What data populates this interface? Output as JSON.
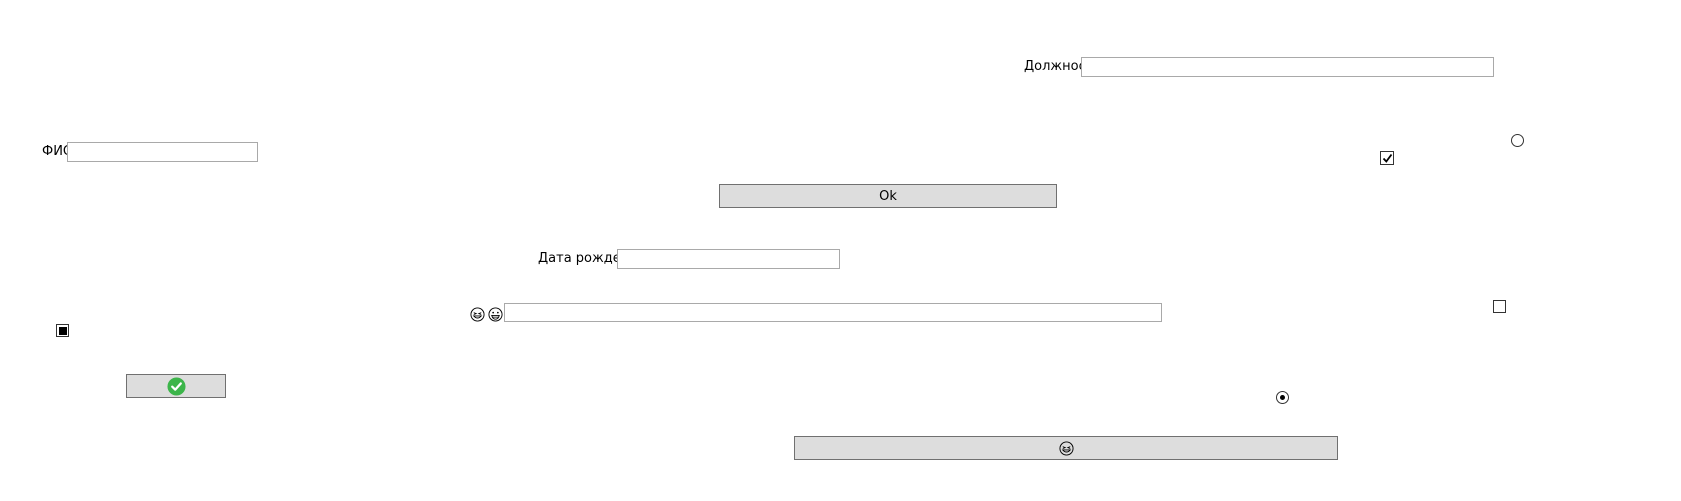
{
  "form": {
    "position_label": "Должность",
    "position_value": "",
    "fio_label": "ФИО",
    "fio_value": "",
    "birthdate_label": "Дата рождения",
    "birthdate_value": "",
    "emoji_field_value": "",
    "ok_button_label": "Ok"
  },
  "controls": {
    "checkbox_checked": true,
    "checkbox_indeterminate": true,
    "checkbox_unchecked": false,
    "radio_unselected": false,
    "radio_selected": true
  },
  "icons": {
    "confirm_button_icon": "check-circle-icon",
    "laugh_emoji": "laughing-emoji-icon",
    "grin_emoji": "grinning-emoji-icon",
    "bottom_button_icon": "laughing-emoji-icon",
    "confirm_color": "#3cb54a"
  }
}
